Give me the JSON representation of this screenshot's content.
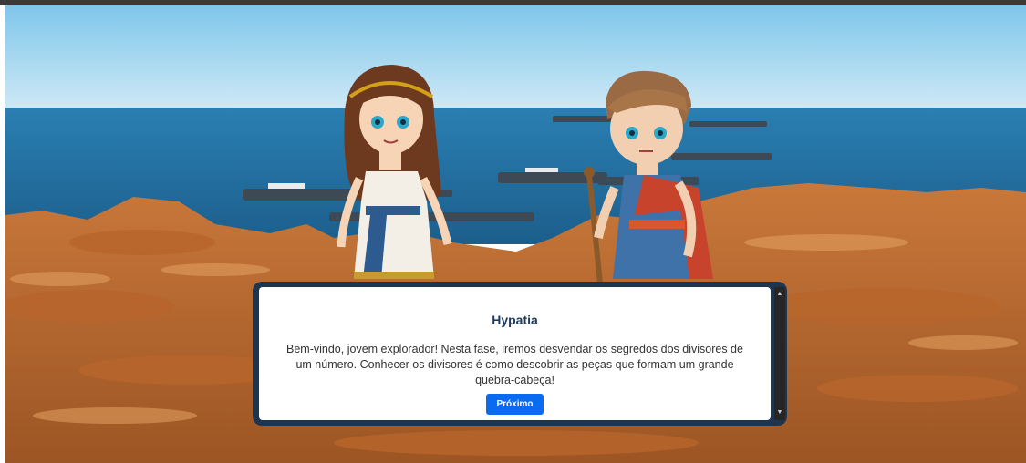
{
  "dialog": {
    "speaker": "Hypatia",
    "message": "Bem-vindo, jovem explorador! Nesta fase, iremos desvendar os segredos dos divisores de um número. Conhecer os divisores é como descobrir as peças que formam um grande quebra-cabeça!",
    "next_label": "Próximo"
  },
  "icons": {
    "scroll_up": "▲",
    "scroll_down": "▼"
  },
  "colors": {
    "dialog_border": "#1e3550",
    "button": "#0b6bf0",
    "speaker_text": "#1f3a5a"
  }
}
